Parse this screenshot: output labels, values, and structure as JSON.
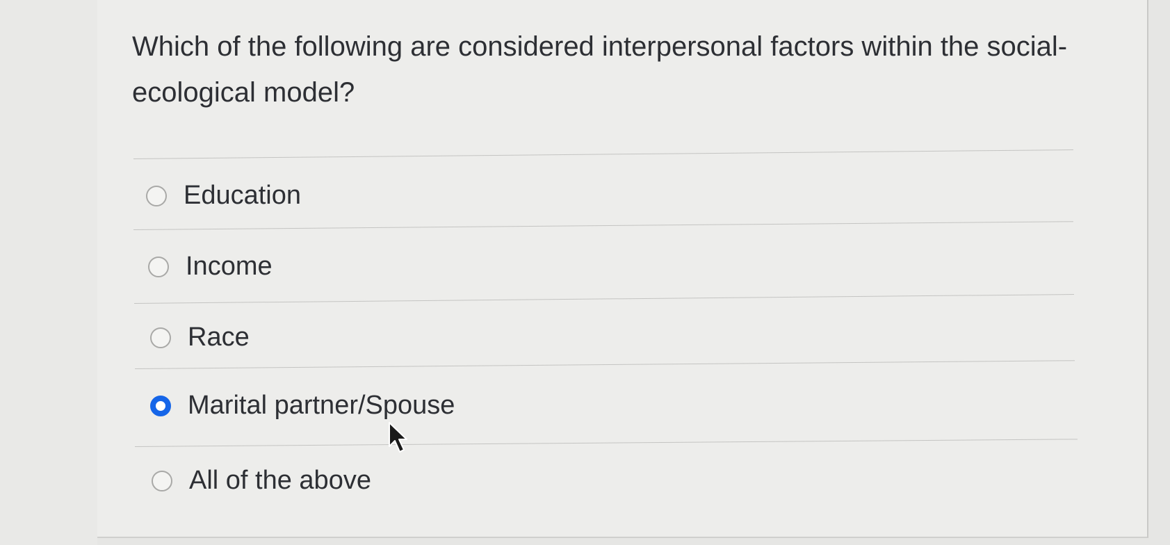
{
  "question": {
    "text": "Which of the following are considered interpersonal factors within the social-ecological model?"
  },
  "options": [
    {
      "label": "Education",
      "selected": false
    },
    {
      "label": "Income",
      "selected": false
    },
    {
      "label": "Race",
      "selected": false
    },
    {
      "label": "Marital partner/Spouse",
      "selected": true
    },
    {
      "label": "All of the above",
      "selected": false
    }
  ],
  "colors": {
    "selected_radio": "#1565e8",
    "text": "#2d2f34",
    "background": "#ededeb"
  },
  "icons": {
    "cursor": "mouse-pointer-icon"
  }
}
